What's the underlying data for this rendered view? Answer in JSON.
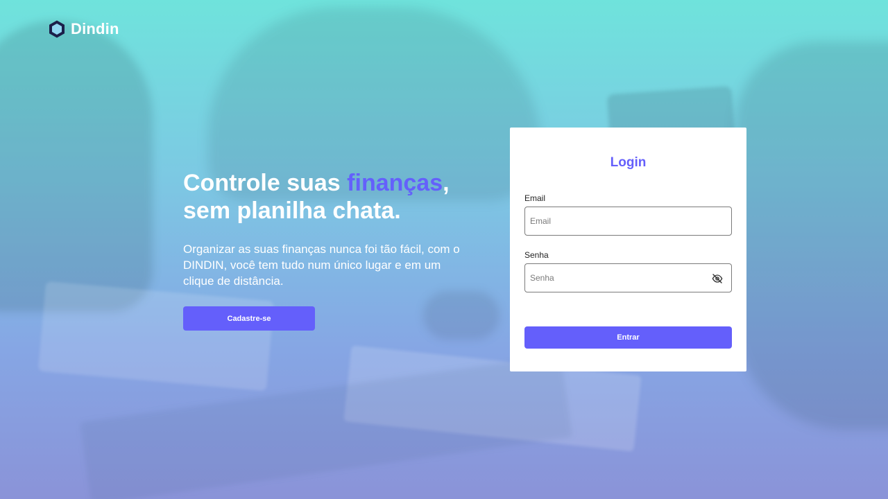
{
  "brand": {
    "name": "Dindin",
    "logo_icon": "hexagon-icon",
    "logo_color": "#1b1f4a"
  },
  "hero": {
    "title_part1": "Controle suas ",
    "title_accent": "finanças",
    "title_part2": ",",
    "title_line2": "sem planilha chata.",
    "subtitle": "Organizar as suas finanças nunca foi tão fácil, com o DINDIN, você tem tudo num único lugar e em um clique de distância.",
    "signup_label": "Cadastre-se"
  },
  "login": {
    "title": "Login",
    "email_label": "Email",
    "email_placeholder": "Email",
    "email_value": "",
    "password_label": "Senha",
    "password_placeholder": "Senha",
    "password_value": "",
    "password_toggle_icon": "eye-off-icon",
    "submit_label": "Entrar"
  },
  "colors": {
    "accent": "#645ffb",
    "text_light": "#ffffff",
    "card_bg": "#ffffff"
  }
}
